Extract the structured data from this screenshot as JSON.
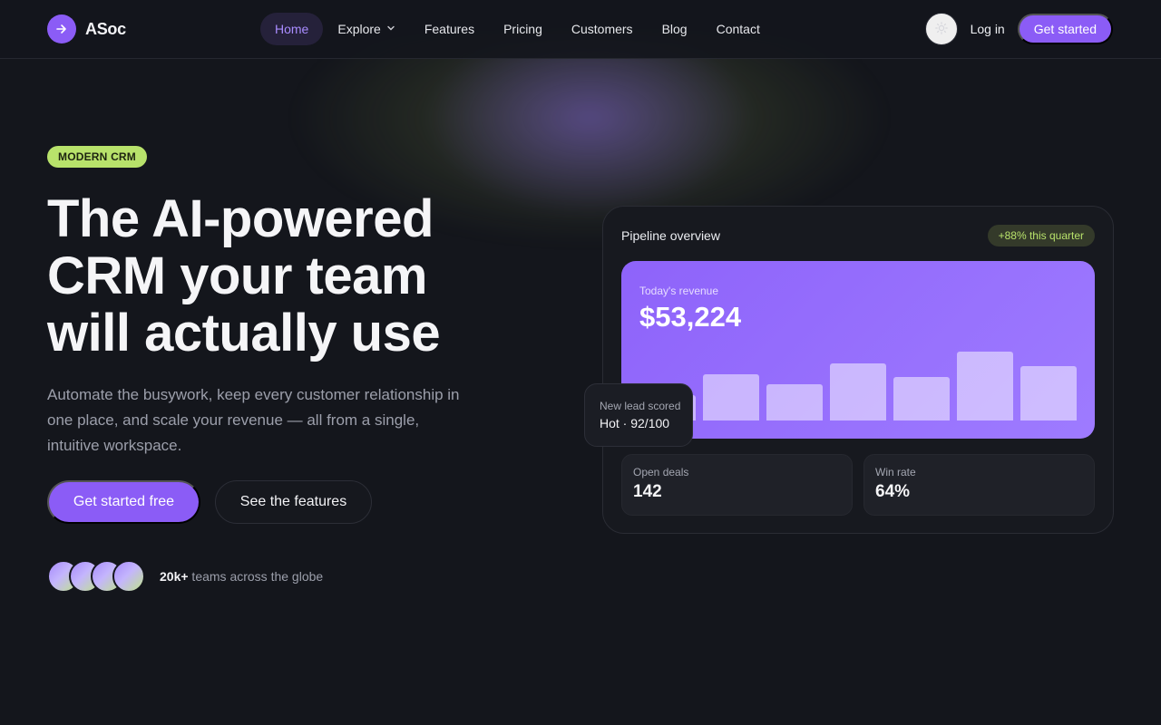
{
  "nav": {
    "logo_icon": "arrow-right-icon",
    "brand": "ASoc",
    "links": [
      {
        "label": "Home",
        "active": true
      },
      {
        "label": "Explore",
        "has_dropdown": true
      },
      {
        "label": "Features"
      },
      {
        "label": "Pricing"
      },
      {
        "label": "Customers"
      },
      {
        "label": "Blog"
      },
      {
        "label": "Contact"
      }
    ],
    "theme_icon": "sun-icon",
    "login": "Log in",
    "cta": "Get started"
  },
  "hero": {
    "badge": "MODERN CRM",
    "headline": "The AI-powered CRM your team will actually use",
    "subtitle": "Automate the busywork, keep every customer relationship in one place, and scale your revenue — all from a single, intuitive workspace.",
    "primary_button": "Get started free",
    "secondary_button": "See the features",
    "social_count": "20k+",
    "social_text": " teams across the globe"
  },
  "dashboard": {
    "title": "Pipeline overview",
    "growth_badge": "+88% this quarter",
    "revenue_label": "Today's revenue",
    "revenue_value": "$53,224",
    "bar_levels": [
      0.32,
      0.58,
      0.45,
      0.72,
      0.54,
      0.86,
      0.68
    ],
    "tooltip_label": "New lead scored",
    "tooltip_value": "Hot · 92/100",
    "stats": [
      {
        "label": "Open deals",
        "value": "142"
      },
      {
        "label": "Win rate",
        "value": "64%"
      }
    ]
  },
  "colors": {
    "accent": "#8b5cf6",
    "lime": "#b8e26b",
    "background": "#14161c"
  }
}
